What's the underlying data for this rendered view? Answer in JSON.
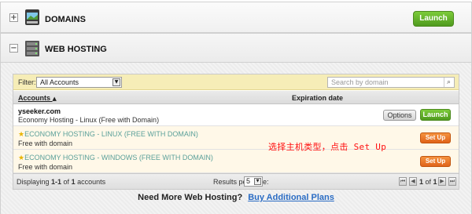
{
  "domains": {
    "title": "DOMAINS",
    "launch_label": "Launch"
  },
  "web_hosting": {
    "title": "WEB HOSTING"
  },
  "filter": {
    "label": "Filter:",
    "selected": "All Accounts",
    "search_placeholder": "Search by domain"
  },
  "columns": {
    "accounts": "Accounts",
    "expiration": "Expiration date"
  },
  "rows": [
    {
      "title": "yseeker.com",
      "subtitle": "Economy Hosting - Linux (Free with Domain)",
      "options_label": "Options",
      "launch_label": "Launch"
    },
    {
      "title": "ECONOMY HOSTING - LINUX (FREE WITH DOMAIN)",
      "subtitle": "Free with domain",
      "button_label": "Set Up"
    },
    {
      "title": "ECONOMY HOSTING - WINDOWS (FREE WITH DOMAIN)",
      "subtitle": "Free with domain",
      "button_label": "Set Up"
    }
  ],
  "annotation": "选择主机类型，点击 Set Up",
  "pager": {
    "displaying_prefix": "Displaying ",
    "range": "1-1",
    "of": " of ",
    "total": "1",
    "suffix": " accounts",
    "rpp_label": "Results per page:",
    "rpp_value": "5",
    "page_current": "1",
    "page_of": " of ",
    "page_total": "1"
  },
  "footer": {
    "question": "Need More Web Hosting?",
    "link": "Buy Additional Plans"
  },
  "colors": {
    "launch_green": "#5aa826",
    "setup_orange": "#e8732a",
    "annotation_red": "#ff1010",
    "link_teal": "#5aa09a"
  },
  "icons": [
    "plus-toggle-icon",
    "domains-icon",
    "minus-toggle-icon",
    "server-icon",
    "dropdown-arrow-icon",
    "search-icon",
    "sort-up-icon",
    "star-icon",
    "first-page-icon",
    "prev-page-icon",
    "next-page-icon",
    "last-page-icon"
  ]
}
